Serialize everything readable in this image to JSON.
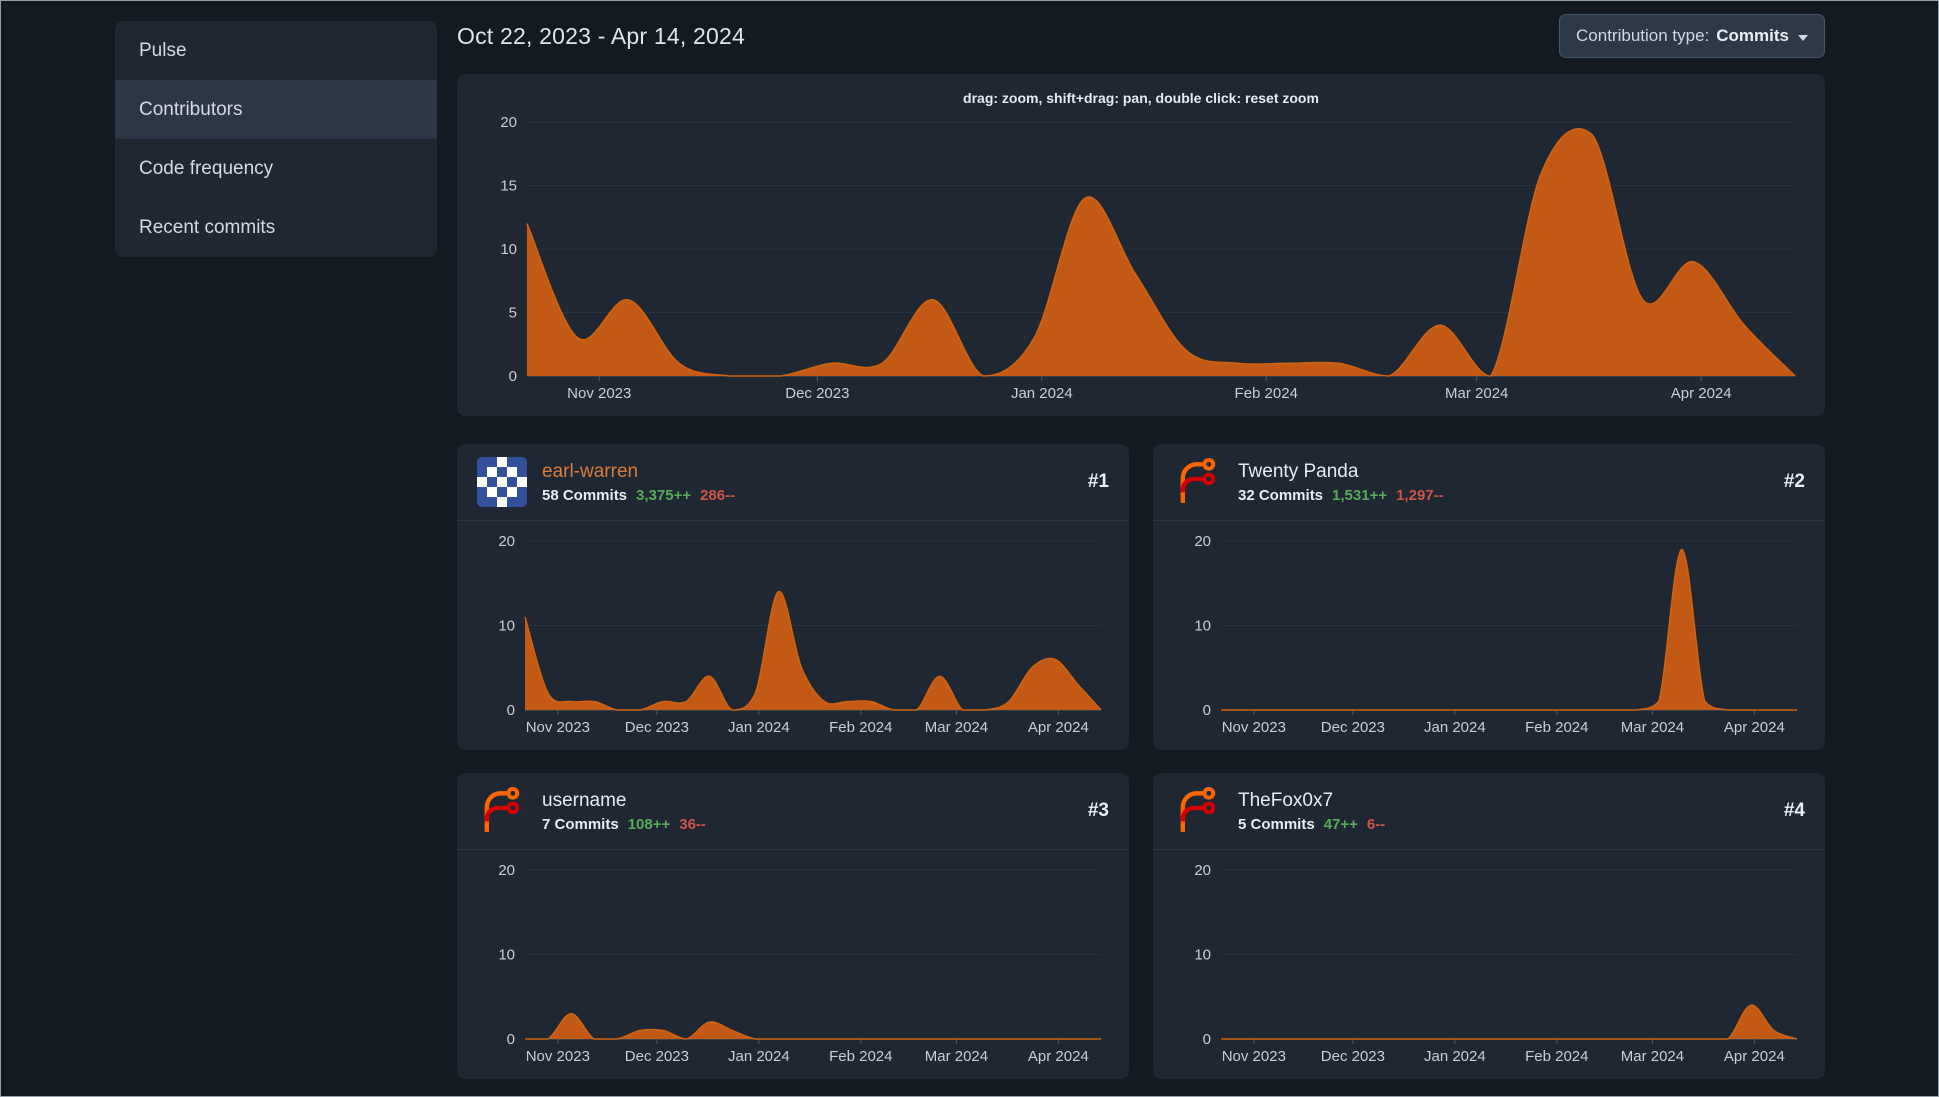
{
  "sidebar": {
    "items": [
      {
        "label": "Pulse",
        "active": false
      },
      {
        "label": "Contributors",
        "active": true
      },
      {
        "label": "Code frequency",
        "active": false
      },
      {
        "label": "Recent commits",
        "active": false
      }
    ]
  },
  "header": {
    "date_range": "Oct 22, 2023 - Apr 14, 2024",
    "contribution_type_label": "Contribution type:",
    "contribution_type_value": "Commits"
  },
  "main_chart": {
    "hint": "drag: zoom, shift+drag: pan, double click: reset zoom"
  },
  "contributors": [
    {
      "rank": "#1",
      "name": "earl-warren",
      "commits": "58 Commits",
      "additions": "3,375++",
      "deletions": "286--",
      "avatar": "identicon"
    },
    {
      "rank": "#2",
      "name": "Twenty Panda",
      "commits": "32 Commits",
      "additions": "1,531++",
      "deletions": "1,297--",
      "avatar": "forgejo-logo"
    },
    {
      "rank": "#3",
      "name": "username",
      "commits": "7 Commits",
      "additions": "108++",
      "deletions": "36--",
      "avatar": "forgejo-logo"
    },
    {
      "rank": "#4",
      "name": "TheFox0x7",
      "commits": "5 Commits",
      "additions": "47++",
      "deletions": "6--",
      "avatar": "forgejo-logo"
    }
  ],
  "colors": {
    "area_fill": "#c25a15",
    "area_line": "#d2630f",
    "additions_green": "#57ab5a",
    "deletions_red": "#cf5449",
    "name_link_orange": "#dd7c3b",
    "background": "#141a22",
    "card": "#1f2732"
  },
  "chart_data": [
    {
      "type": "area",
      "name": "repository-commits-total",
      "title": "Commits per week, Oct 22, 2023 - Apr 14, 2024",
      "interval": "weekly",
      "tick_labels": [
        "Nov 2023",
        "Dec 2023",
        "Jan 2024",
        "Feb 2024",
        "Mar 2024",
        "Apr 2024"
      ],
      "tick_positions": [
        0.057,
        0.229,
        0.406,
        0.583,
        0.749,
        0.926
      ],
      "values": [
        12,
        3,
        6,
        1,
        0,
        0,
        1,
        1,
        6,
        0,
        3,
        14,
        8,
        2,
        1,
        1,
        1,
        0,
        4,
        0,
        16,
        19,
        6,
        9,
        4,
        0
      ],
      "yticks": [
        0,
        5,
        10,
        15,
        20
      ],
      "ylim": [
        0,
        20
      ]
    },
    {
      "type": "area",
      "name": "earl-warren-commits",
      "title": "earl-warren commits per week",
      "interval": "weekly",
      "tick_labels": [
        "Nov 2023",
        "Dec 2023",
        "Jan 2024",
        "Feb 2024",
        "Mar 2024",
        "Apr 2024"
      ],
      "tick_positions": [
        0.057,
        0.229,
        0.406,
        0.583,
        0.749,
        0.926
      ],
      "values": [
        11,
        2,
        1,
        1,
        0,
        0,
        1,
        1,
        4,
        0,
        2,
        14,
        5,
        1,
        1,
        1,
        0,
        0,
        4,
        0,
        0,
        1,
        5,
        6,
        3,
        0
      ],
      "yticks": [
        0,
        10,
        20
      ],
      "ylim": [
        0,
        20
      ]
    },
    {
      "type": "area",
      "name": "twenty-panda-commits",
      "title": "Twenty Panda commits per week",
      "interval": "weekly",
      "tick_labels": [
        "Nov 2023",
        "Dec 2023",
        "Jan 2024",
        "Feb 2024",
        "Mar 2024",
        "Apr 2024"
      ],
      "tick_positions": [
        0.057,
        0.229,
        0.406,
        0.583,
        0.749,
        0.926
      ],
      "values": [
        0,
        0,
        0,
        0,
        0,
        0,
        0,
        0,
        0,
        0,
        0,
        0,
        0,
        0,
        0,
        0,
        0,
        0,
        0,
        1,
        19,
        1,
        0,
        0,
        0,
        0
      ],
      "yticks": [
        0,
        10,
        20
      ],
      "ylim": [
        0,
        20
      ]
    },
    {
      "type": "area",
      "name": "username-commits",
      "title": "username commits per week",
      "interval": "weekly",
      "tick_labels": [
        "Nov 2023",
        "Dec 2023",
        "Jan 2024",
        "Feb 2024",
        "Mar 2024",
        "Apr 2024"
      ],
      "tick_positions": [
        0.057,
        0.229,
        0.406,
        0.583,
        0.749,
        0.926
      ],
      "values": [
        0,
        0,
        3,
        0,
        0,
        1,
        1,
        0,
        2,
        1,
        0,
        0,
        0,
        0,
        0,
        0,
        0,
        0,
        0,
        0,
        0,
        0,
        0,
        0,
        0,
        0
      ],
      "yticks": [
        0,
        10,
        20
      ],
      "ylim": [
        0,
        20
      ]
    },
    {
      "type": "area",
      "name": "thefox0x7-commits",
      "title": "TheFox0x7 commits per week",
      "interval": "weekly",
      "tick_labels": [
        "Nov 2023",
        "Dec 2023",
        "Jan 2024",
        "Feb 2024",
        "Mar 2024",
        "Apr 2024"
      ],
      "tick_positions": [
        0.057,
        0.229,
        0.406,
        0.583,
        0.749,
        0.926
      ],
      "values": [
        0,
        0,
        0,
        0,
        0,
        0,
        0,
        0,
        0,
        0,
        0,
        0,
        0,
        0,
        0,
        0,
        0,
        0,
        0,
        0,
        0,
        0,
        0,
        4,
        1,
        0
      ],
      "yticks": [
        0,
        10,
        20
      ],
      "ylim": [
        0,
        20
      ]
    }
  ]
}
